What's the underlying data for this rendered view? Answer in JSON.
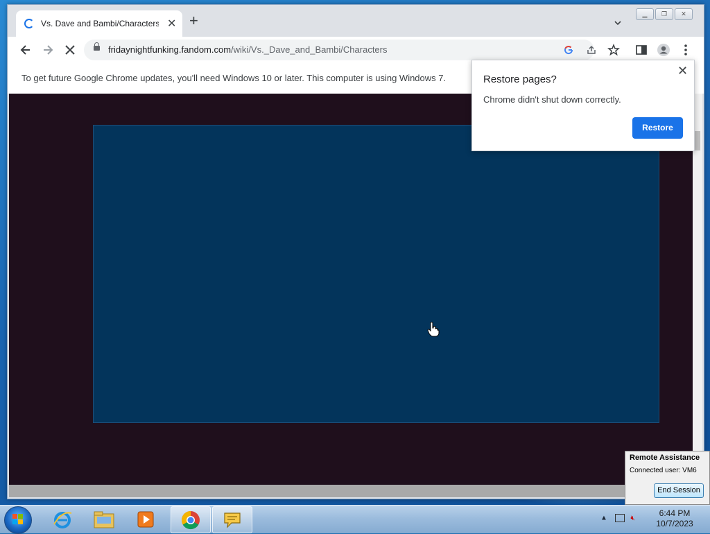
{
  "browser": {
    "tab_title": "Vs. Dave and Bambi/Characters |",
    "url_host": "fridaynightfunking.fandom.com",
    "url_path": "/wiki/Vs._Dave_and_Bambi/Characters",
    "infobar_text": "To get future Google Chrome updates, you'll need Windows 10 or later. This computer is using Windows 7.",
    "icons": [
      "back-arrow-icon",
      "forward-arrow-icon",
      "stop-loading-icon",
      "google-icon",
      "share-icon",
      "bookmark-star-icon",
      "side-panel-icon",
      "profile-icon",
      "kebab-menu-icon"
    ]
  },
  "restore_popup": {
    "title": "Restore pages?",
    "message": "Chrome didn't shut down correctly.",
    "button": "Restore"
  },
  "remote_assistance": {
    "title": "Remote Assistance",
    "connected_user": "Connected user:  VM6",
    "end_button": "End Session"
  },
  "taskbar": {
    "apps": [
      "internet-explorer-icon",
      "file-explorer-icon",
      "media-player-icon",
      "chrome-icon",
      "remote-assistance-icon"
    ],
    "time": "6:44 PM",
    "date": "10/7/2023"
  },
  "colors": {
    "page_background": "#1f0f1c",
    "content_panel": "#03345b",
    "accent_blue": "#1a73e8"
  }
}
